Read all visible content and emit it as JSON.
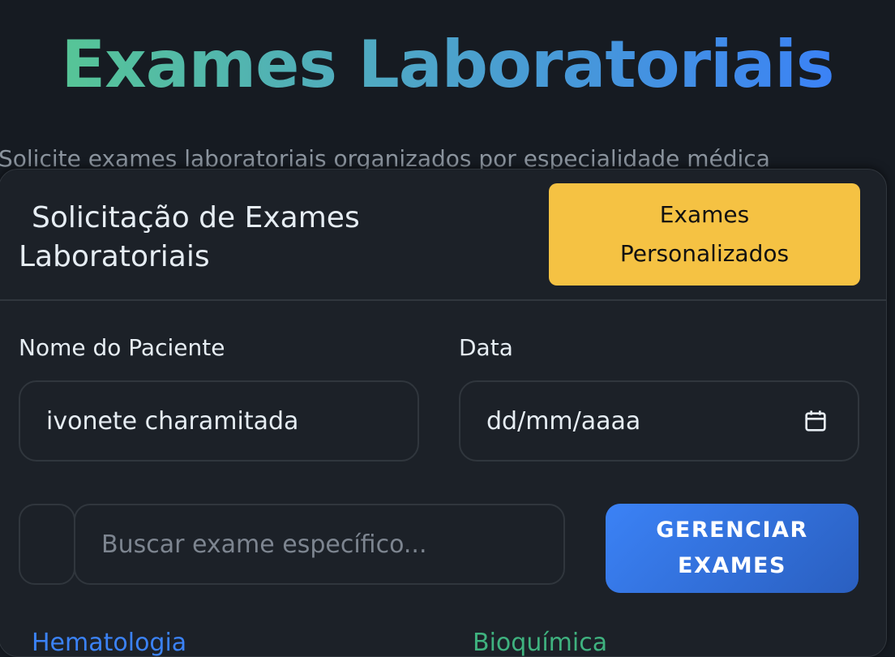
{
  "page": {
    "title": "Exames Laboratoriais",
    "subtitle": "Solicite exames laboratoriais organizados por especialidade médica"
  },
  "card": {
    "title_line1": "Solicitação de Exames",
    "title_line2": "Laboratoriais",
    "custom_exams_button_line1": "Exames",
    "custom_exams_button_line2": "Personalizados"
  },
  "form": {
    "patient_label": "Nome do Paciente",
    "patient_value": "ivonete charamitada",
    "date_label": "Data",
    "date_placeholder": "dd/mm/aaaa",
    "search_placeholder": "Buscar exame específico...",
    "manage_button_line1": "GERENCIAR",
    "manage_button_line2": "EXAMES"
  },
  "categories": [
    {
      "label": "Hematologia",
      "color": "#3b82f6"
    },
    {
      "label": "Bioquímica",
      "color": "#3fb27f"
    }
  ],
  "icons": {
    "date_picker": "calendar-icon",
    "search": "search-icon"
  },
  "colors": {
    "accent_yellow": "#f5c243",
    "accent_blue": "#3b82f6",
    "title_gradient_start": "#56c596",
    "title_gradient_end": "#3b82f6"
  }
}
